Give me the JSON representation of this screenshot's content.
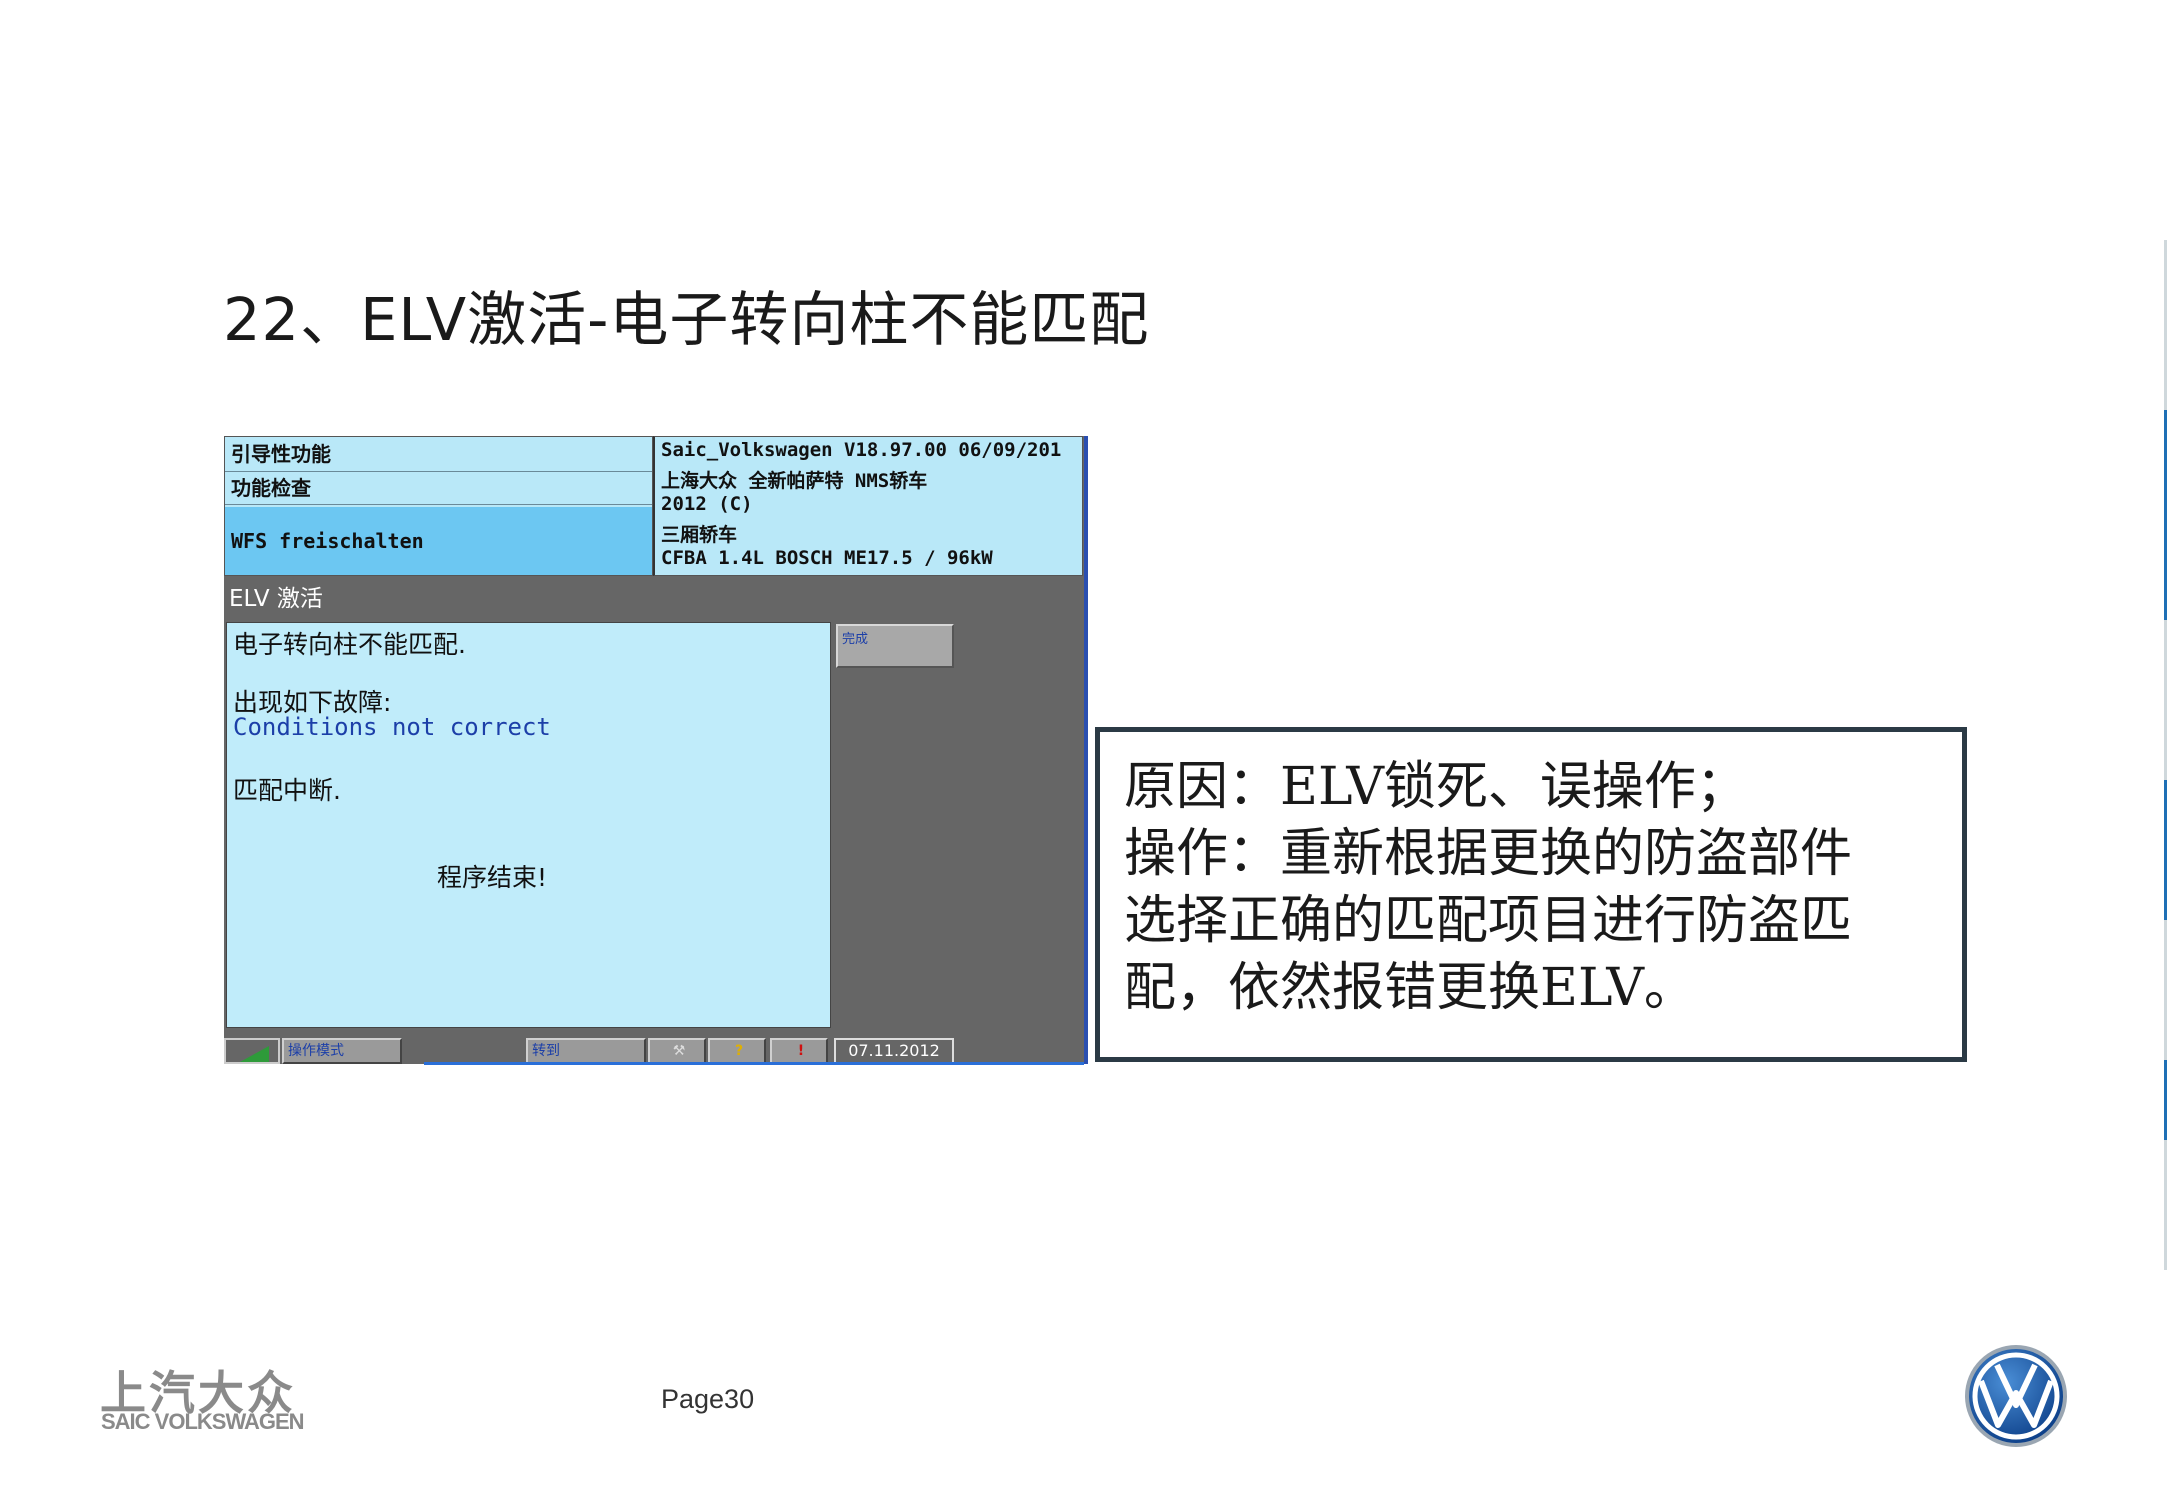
{
  "slide": {
    "title": "22、ELV激活-电子转向柱不能匹配",
    "page": "Page30"
  },
  "diagnostic": {
    "nav_items": [
      "引导性功能",
      "功能检查",
      "WFS freischalten"
    ],
    "vehicle_info": [
      "Saic_Volkswagen  V18.97.00 06/09/201",
      "上海大众 全新帕萨特 NMS轿车",
      "2012 (C)",
      "三厢轿车",
      "CFBA 1.4L BOSCH ME17.5 / 96kW"
    ],
    "module_title": "ELV 激活",
    "messages": {
      "line1": "电子转向柱不能匹配.",
      "line2": "出现如下故障:",
      "line3": "Conditions not correct",
      "line4": "匹配中断.",
      "line5": "程序结束!"
    },
    "done_button": "完成",
    "status_bar": {
      "mode_button": "操作模式",
      "goto_button": "转到",
      "help_button": "?",
      "warning_button": "!",
      "date": "07.11.2012"
    }
  },
  "callout": {
    "line1": "原因：ELV锁死、误操作；",
    "line2": "操作：重新根据更换的防盗部件",
    "line3": "选择正确的匹配项目进行防盗匹",
    "line4": "配，依然报错更换ELV。"
  },
  "footer": {
    "logo_cn": "上汽大众",
    "logo_en": "SAIC VOLKSWAGEN"
  }
}
